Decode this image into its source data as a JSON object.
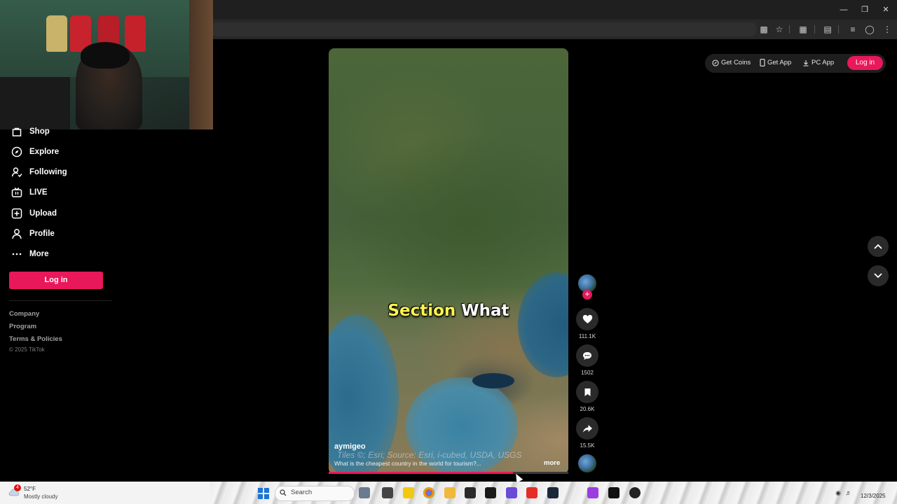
{
  "browser": {
    "window_controls": [
      "minimize-icon",
      "restore-icon",
      "close-icon"
    ],
    "toolbar_icons": [
      "cast-icon",
      "star-icon",
      "extensions-icon",
      "media-icon",
      "reading-list-icon",
      "account-icon",
      "menu-icon"
    ]
  },
  "sidebar": {
    "items": [
      {
        "label": "Shop",
        "icon": "shop-icon"
      },
      {
        "label": "Explore",
        "icon": "compass-icon"
      },
      {
        "label": "Following",
        "icon": "following-icon"
      },
      {
        "label": "LIVE",
        "icon": "live-icon"
      },
      {
        "label": "Upload",
        "icon": "upload-icon"
      },
      {
        "label": "Profile",
        "icon": "profile-icon"
      },
      {
        "label": "More",
        "icon": "more-icon"
      }
    ],
    "login_label": "Log in",
    "footer_links": [
      "Company",
      "Program",
      "Terms & Policies"
    ],
    "copyright": "© 2025 TikTok"
  },
  "topbar": {
    "get_coins": "Get Coins",
    "get_app": "Get App",
    "pc_app": "PC App",
    "login": "Log in"
  },
  "video": {
    "caption_highlight": "Section",
    "caption_rest": "What",
    "attribution": "Tiles ©; Esri; Source: Esri, i-cubed, USDA, USGS",
    "author": "aymigeo",
    "description": "What is the cheapest country in the world for tourism?...",
    "more": "more",
    "progress": 0.77
  },
  "actions": {
    "likes": "111.1K",
    "comments": "1502",
    "saves": "20.6K",
    "shares": "15.5K"
  },
  "taskbar": {
    "weather_badge": "4",
    "temperature": "52°F",
    "condition": "Mostly cloudy",
    "search_label": "Search",
    "date": "12/3/2025"
  },
  "colors": {
    "accent": "#e8185a",
    "caption_highlight": "#fff44f"
  }
}
